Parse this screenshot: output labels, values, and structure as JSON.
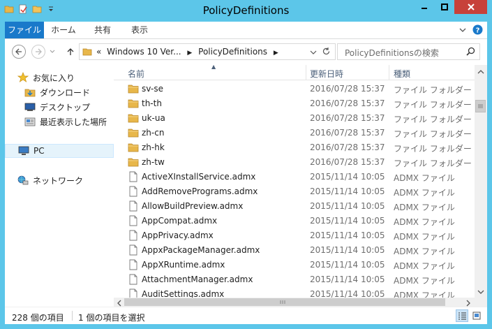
{
  "window": {
    "title": "PolicyDefinitions",
    "accent": "#5cc6e9",
    "close_color": "#c7413a"
  },
  "ribbon": {
    "tabs": [
      "ファイル",
      "ホーム",
      "共有",
      "表示"
    ]
  },
  "address": {
    "prefix": "«",
    "crumb1": "Windows 10 Ver...",
    "crumb2": "PolicyDefinitions"
  },
  "search": {
    "placeholder": "PolicyDefinitionsの検索"
  },
  "nav": {
    "favorites": "お気に入り",
    "downloads": "ダウンロード",
    "desktop": "デスクトップ",
    "recent": "最近表示した場所",
    "pc": "PC",
    "network": "ネットワーク"
  },
  "columns": {
    "name": "名前",
    "date": "更新日時",
    "type": "種類"
  },
  "files": [
    {
      "name": "sv-se",
      "date": "2016/07/28 15:37",
      "type": "ファイル フォルダー",
      "icon": "folder-icon"
    },
    {
      "name": "th-th",
      "date": "2016/07/28 15:37",
      "type": "ファイル フォルダー",
      "icon": "folder-icon"
    },
    {
      "name": "uk-ua",
      "date": "2016/07/28 15:37",
      "type": "ファイル フォルダー",
      "icon": "folder-icon"
    },
    {
      "name": "zh-cn",
      "date": "2016/07/28 15:37",
      "type": "ファイル フォルダー",
      "icon": "folder-icon"
    },
    {
      "name": "zh-hk",
      "date": "2016/07/28 15:37",
      "type": "ファイル フォルダー",
      "icon": "folder-icon"
    },
    {
      "name": "zh-tw",
      "date": "2016/07/28 15:37",
      "type": "ファイル フォルダー",
      "icon": "folder-icon"
    },
    {
      "name": "ActiveXInstallService.admx",
      "date": "2015/11/14 10:05",
      "type": "ADMX ファイル",
      "icon": "file-icon"
    },
    {
      "name": "AddRemovePrograms.admx",
      "date": "2015/11/14 10:05",
      "type": "ADMX ファイル",
      "icon": "file-icon"
    },
    {
      "name": "AllowBuildPreview.admx",
      "date": "2015/11/14 10:05",
      "type": "ADMX ファイル",
      "icon": "file-icon"
    },
    {
      "name": "AppCompat.admx",
      "date": "2015/11/14 10:05",
      "type": "ADMX ファイル",
      "icon": "file-icon"
    },
    {
      "name": "AppPrivacy.admx",
      "date": "2015/11/14 10:05",
      "type": "ADMX ファイル",
      "icon": "file-icon"
    },
    {
      "name": "AppxPackageManager.admx",
      "date": "2015/11/14 10:05",
      "type": "ADMX ファイル",
      "icon": "file-icon"
    },
    {
      "name": "AppXRuntime.admx",
      "date": "2015/11/14 10:05",
      "type": "ADMX ファイル",
      "icon": "file-icon"
    },
    {
      "name": "AttachmentManager.admx",
      "date": "2015/11/14 10:05",
      "type": "ADMX ファイル",
      "icon": "file-icon"
    },
    {
      "name": "AuditSettings.admx",
      "date": "2015/11/14 10:05",
      "type": "ADMX ファイル",
      "icon": "file-icon"
    }
  ],
  "status": {
    "count": "228 個の項目",
    "selected": "1 個の項目を選択"
  }
}
